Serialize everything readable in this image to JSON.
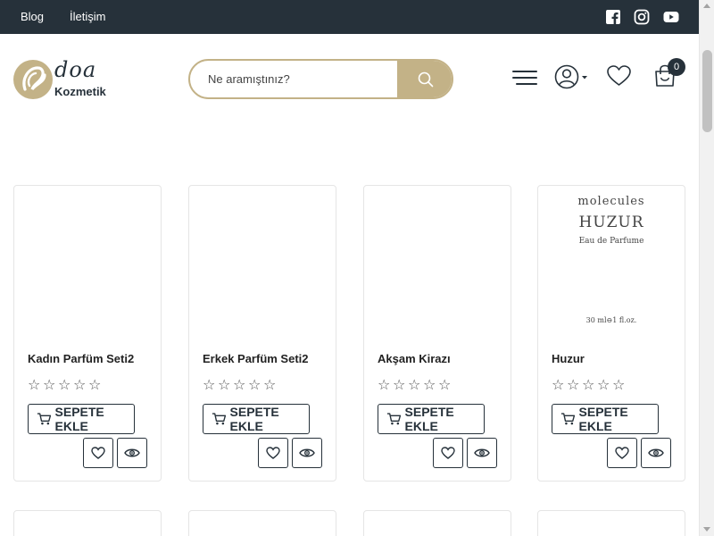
{
  "topbar": {
    "links": [
      {
        "label": "Blog"
      },
      {
        "label": "İletişim"
      }
    ],
    "social": [
      "facebook-icon",
      "instagram-icon",
      "youtube-icon"
    ],
    "bg_color": "#26313a"
  },
  "header": {
    "logo": {
      "main": "doa",
      "sub": "Kozmetik"
    },
    "search": {
      "placeholder": "Ne aramıştınız?"
    },
    "cart_count": "0",
    "accent_color": "#c3b287"
  },
  "products": [
    {
      "name": "Kadın Parfüm Seti2",
      "add_label": "SEPETE EKLE",
      "rating": 0
    },
    {
      "name": "Erkek Parfüm Seti2",
      "add_label": "SEPETE EKLE",
      "rating": 0
    },
    {
      "name": "Akşam Kirazı",
      "add_label": "SEPETE EKLE",
      "rating": 0
    },
    {
      "name": "Huzur",
      "add_label": "SEPETE EKLE",
      "rating": 0,
      "image_text": {
        "brand": "molecules",
        "name": "HUZUR",
        "type": "Eau de Parfume",
        "volume": "30 ml⊖1 fl.oz."
      }
    }
  ],
  "icons": {
    "menu": "hamburger-icon",
    "account": "user-icon",
    "wishlist": "heart-icon",
    "cart": "shopping-bag-icon",
    "search": "search-icon",
    "add_to_cart": "cart-icon",
    "quick_view": "eye-icon"
  }
}
